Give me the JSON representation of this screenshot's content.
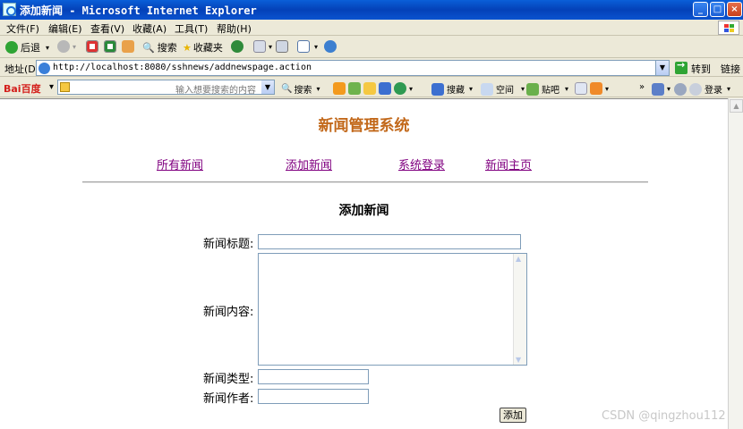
{
  "window": {
    "title": "添加新闻 - Microsoft Internet Explorer",
    "controls": {
      "minimize": "_",
      "maximize": "□",
      "close": "×"
    }
  },
  "menu": [
    "文件(F)",
    "编辑(E)",
    "查看(V)",
    "收藏(A)",
    "工具(T)",
    "帮助(H)"
  ],
  "toolbar": {
    "back": "后退",
    "search": "搜索",
    "favorites": "收藏夹"
  },
  "address": {
    "label": "地址(D)",
    "url": "http://localhost:8080/sshnews/addnewspage.action",
    "go": "转到",
    "links": "链接"
  },
  "baidu": {
    "logo": "Bai百度",
    "placeholder": "输入想要搜索的内容",
    "search": "搜索",
    "collect": "搜藏",
    "space": "空间",
    "tieba": "贴吧",
    "login": "登录"
  },
  "page": {
    "title": "新闻管理系统",
    "nav": [
      "所有新闻",
      "添加新闻",
      "系统登录",
      "新闻主页"
    ],
    "form_title": "添加新闻",
    "fields": {
      "title_label": "新闻标题:",
      "content_label": "新闻内容:",
      "type_label": "新闻类型:",
      "author_label": "新闻作者:"
    },
    "submit": "添加"
  },
  "watermark": "CSDN @qingzhou112"
}
